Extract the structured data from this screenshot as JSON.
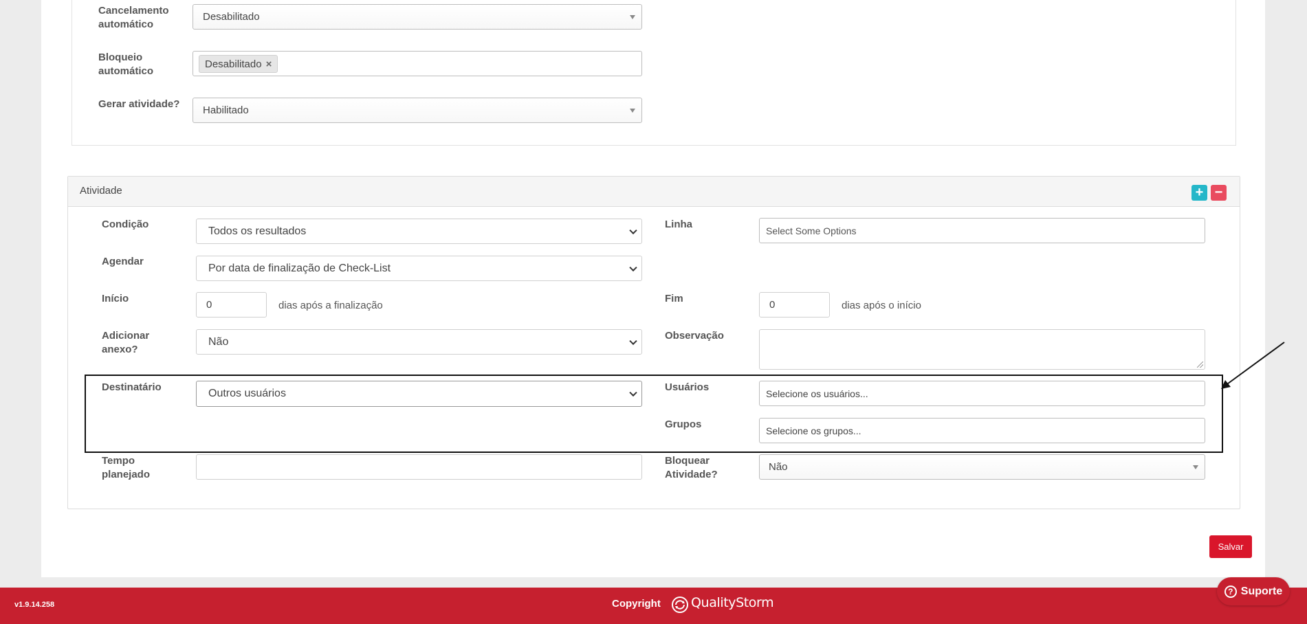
{
  "config": {
    "auto_cancel": {
      "label": "Cancelamento automático",
      "value": "Desabilitado"
    },
    "auto_block": {
      "label": "Bloqueio automático",
      "tag": "Desabilitado",
      "tag_remove": "×"
    },
    "generate_activity": {
      "label": "Gerar atividade?",
      "value": "Habilitado"
    }
  },
  "activity": {
    "title": "Atividade",
    "add_label": "+",
    "remove_label": "−",
    "condition": {
      "label": "Condição",
      "value": "Todos os resultados"
    },
    "line": {
      "label": "Linha",
      "placeholder": "Select Some Options"
    },
    "schedule": {
      "label": "Agendar",
      "value": "Por data de finalização de Check-List"
    },
    "start": {
      "label": "Início",
      "value": "0",
      "suffix": "dias após a finalização"
    },
    "end": {
      "label": "Fim",
      "value": "0",
      "suffix": "dias após o início"
    },
    "attachment": {
      "label": "Adicionar anexo?",
      "value": "Não"
    },
    "observation": {
      "label": "Observação",
      "value": ""
    },
    "recipient": {
      "label": "Destinatário",
      "value": "Outros usuários"
    },
    "users": {
      "label": "Usuários",
      "placeholder": "Selecione os usuários..."
    },
    "groups": {
      "label": "Grupos",
      "placeholder": "Selecione os grupos..."
    },
    "planned_time": {
      "label": "Tempo planejado",
      "value": ""
    },
    "block_activity": {
      "label": "Bloquear Atividade?",
      "value": "Não"
    }
  },
  "actions": {
    "save_label": "Salvar"
  },
  "footer": {
    "version": "v1.9.14.258",
    "copyright": "Copyright",
    "brand": "QualityStorm",
    "support_label": "Suporte",
    "support_icon": "?"
  },
  "colors": {
    "primary_red": "#c6202f",
    "save_red": "#d9162b",
    "add_teal": "#25b7c9",
    "remove_pink": "#e94b5f"
  }
}
